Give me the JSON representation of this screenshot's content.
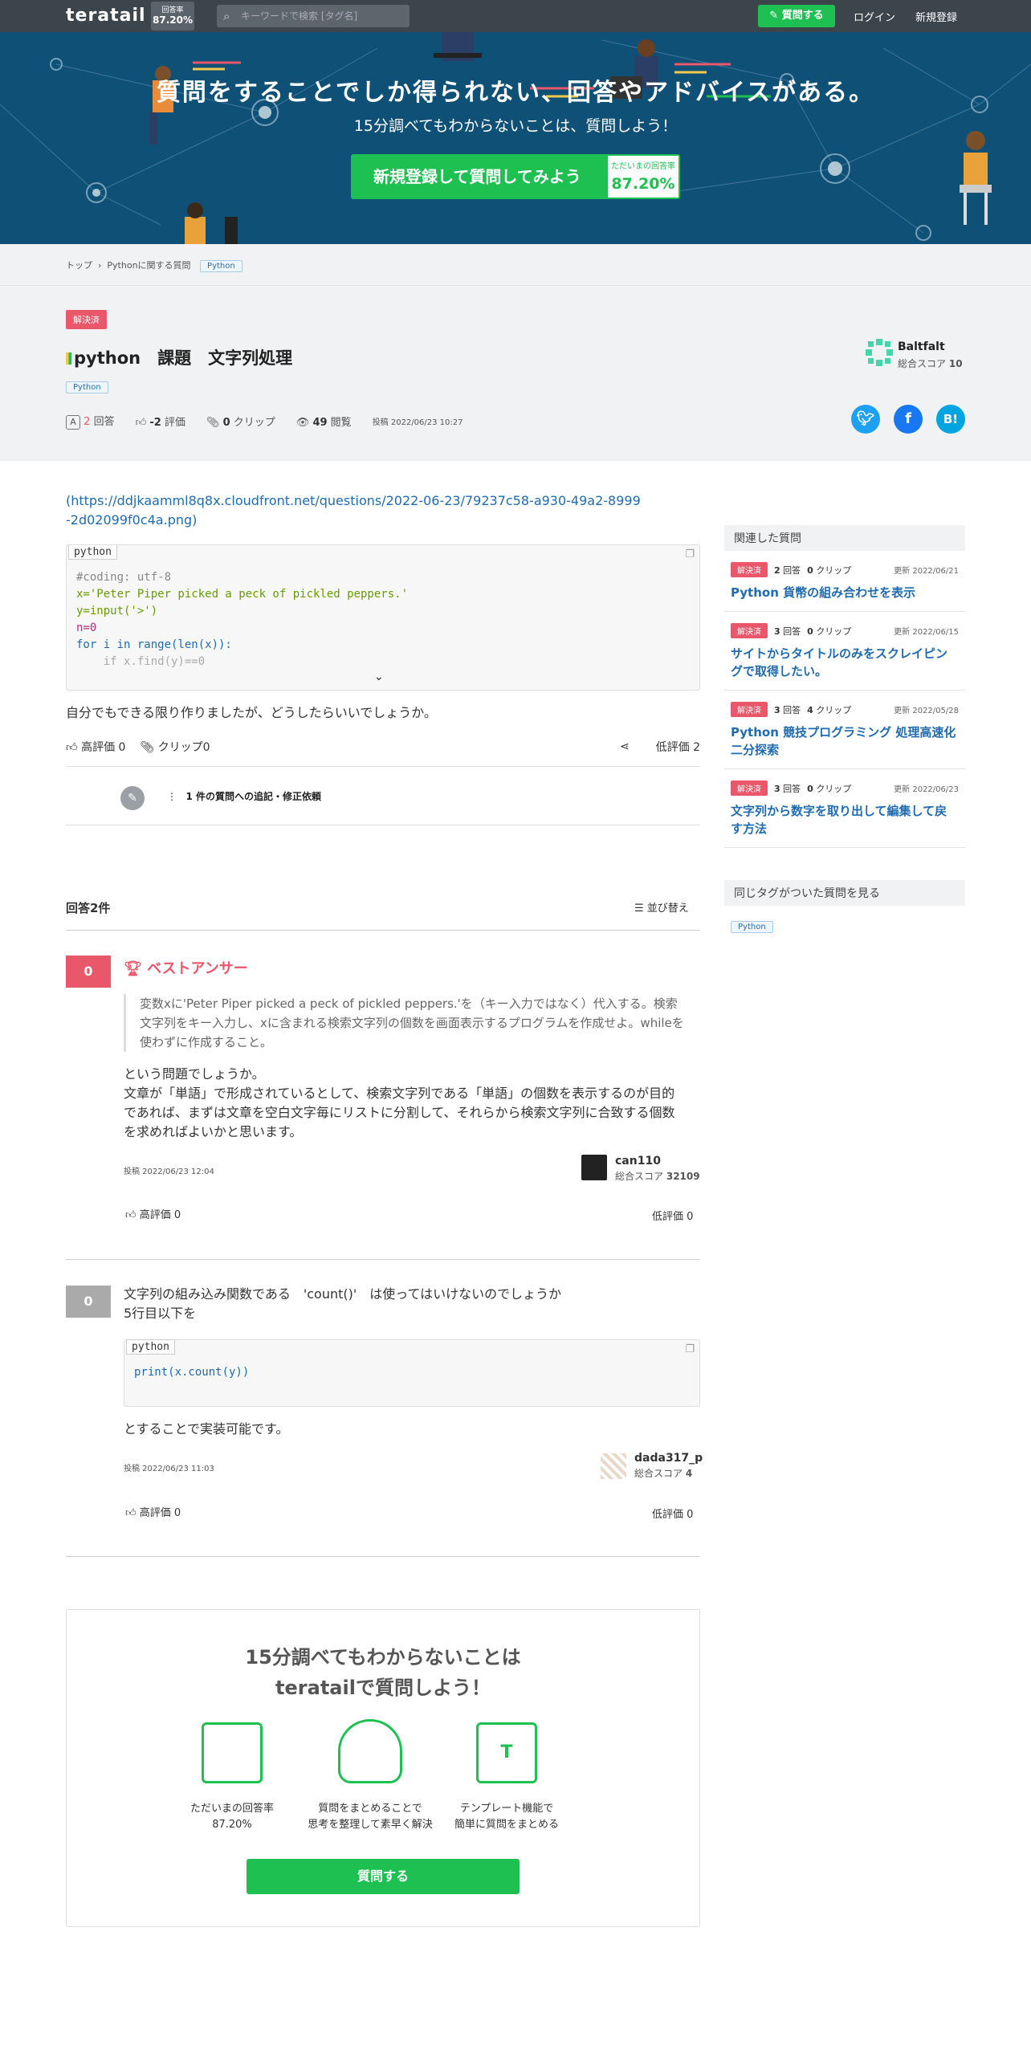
{
  "header": {
    "logo": "teratail",
    "rate_label": "回答率",
    "rate_value": "87.20%",
    "search_placeholder": "キーワードで検索 [タグ名]",
    "ask_button": "質問する",
    "login": "ログイン",
    "signup": "新規登録"
  },
  "hero": {
    "title": "質問をすることでしか得られない、回答やアドバイスがある。",
    "subtitle": "15分調べてもわからないことは、質問しよう！",
    "cta": "新規登録して質問してみよう",
    "badge_label": "ただいまの回答率",
    "badge_value": "87.20%"
  },
  "breadcrumb": {
    "top": "トップ",
    "category": "Pythonに関する質問",
    "tag": "Python"
  },
  "question": {
    "status": "解決済",
    "title": "python　課題　文字列処理",
    "tag": "Python",
    "answers_count": "2",
    "answers_label": "回答",
    "score": "-2",
    "score_label": "評価",
    "clips": "0",
    "clips_label": "クリップ",
    "views": "49",
    "views_label": "閲覧",
    "posted": "投稿 2022/06/23 10:27",
    "link": "(https://ddjkaamml8q8x.cloudfront.net/questions/2022-06-23/79237c58-a930-49a2-8999-2d02099f0c4a.png)",
    "code_lang": "python",
    "code_lines": [
      "#coding: utf-8",
      "x='Peter Piper picked a peck of pickled peppers.'",
      "y=input('>')",
      "n=0",
      "for i in range(len(x)):",
      "    if x.find(y)==0"
    ],
    "text": "自分でもできる限り作りましたが、どうしたらいいでしょうか。",
    "good": "高評価 0",
    "clip": "クリップ0",
    "bad": "低評価 2",
    "edit_request": "1 件の質問への追記・修正依頼"
  },
  "user": {
    "name": "Baltfalt",
    "score_label": "総合スコア",
    "score": "10"
  },
  "answers": {
    "header": "回答2件",
    "sort": "並び替え",
    "a1": {
      "score": "0",
      "best": "ベストアンサー",
      "quote": "変数xに'Peter Piper picked a peck of pickled peppers.'を（キー入力ではなく）代入する。検索文字列をキー入力し、xに含まれる検索文字列の個数を画面表示するプログラムを作成せよ。whileを使わずに作成すること。",
      "text1": "という問題でしょうか。",
      "text2": "文章が「単語」で形成されているとして、検索文字列である「単語」の個数を表示するのが目的であれば、まずは文章を空白文字毎にリストに分割して、それらから検索文字列に合致する個数を求めればよいかと思います。",
      "posted": "投稿 2022/06/23 12:04",
      "user": "can110",
      "user_score_label": "総合スコア",
      "user_score": "32109",
      "good": "高評価 0",
      "bad": "低評価 0"
    },
    "a2": {
      "score": "0",
      "text1": "文字列の組み込み関数である　'count()'　は使ってはいけないのでしょうか",
      "text2": "5行目以下を",
      "code_lang": "python",
      "code": "print(x.count(y))",
      "text3": "とすることで実装可能です。",
      "posted": "投稿 2022/06/23 11:03",
      "user": "dada317_p",
      "user_score_label": "総合スコア",
      "user_score": "4",
      "good": "高評価 0",
      "bad": "低評価 0"
    }
  },
  "sidebar": {
    "related_header": "関連した質問",
    "related": [
      {
        "status": "解決済",
        "answers": "2",
        "answers_label": "回答",
        "clips": "0",
        "clips_label": "クリップ",
        "date": "更新 2022/06/21",
        "title": "Python 貨幣の組み合わせを表示"
      },
      {
        "status": "解決済",
        "answers": "3",
        "answers_label": "回答",
        "clips": "0",
        "clips_label": "クリップ",
        "date": "更新 2022/06/15",
        "title": "サイトからタイトルのみをスクレイピングで取得したい。"
      },
      {
        "status": "解決済",
        "answers": "3",
        "answers_label": "回答",
        "clips": "4",
        "clips_label": "クリップ",
        "date": "更新 2022/05/28",
        "title": "Python 競技プログラミング 処理高速化 二分探索"
      },
      {
        "status": "解決済",
        "answers": "3",
        "answers_label": "回答",
        "clips": "0",
        "clips_label": "クリップ",
        "date": "更新 2022/06/23",
        "title": "文字列から数字を取り出して編集して戻す方法"
      }
    ],
    "same_tag_header": "同じタグがついた質問を見る",
    "same_tag": "Python"
  },
  "footer_cta": {
    "title1": "15分調べてもわからないことは",
    "title2": "teratailで質問しよう！",
    "f1a": "ただいまの回答率",
    "f1b": "87.20%",
    "f2a": "質問をまとめることで",
    "f2b": "思考を整理して素早く解決",
    "f3a": "テンプレート機能で",
    "f3b": "簡単に質問をまとめる",
    "button": "質問する"
  },
  "colors": {
    "green": "#1ec052",
    "red": "#e9576b",
    "navy": "#0f5176",
    "link": "#1f6bb0"
  }
}
